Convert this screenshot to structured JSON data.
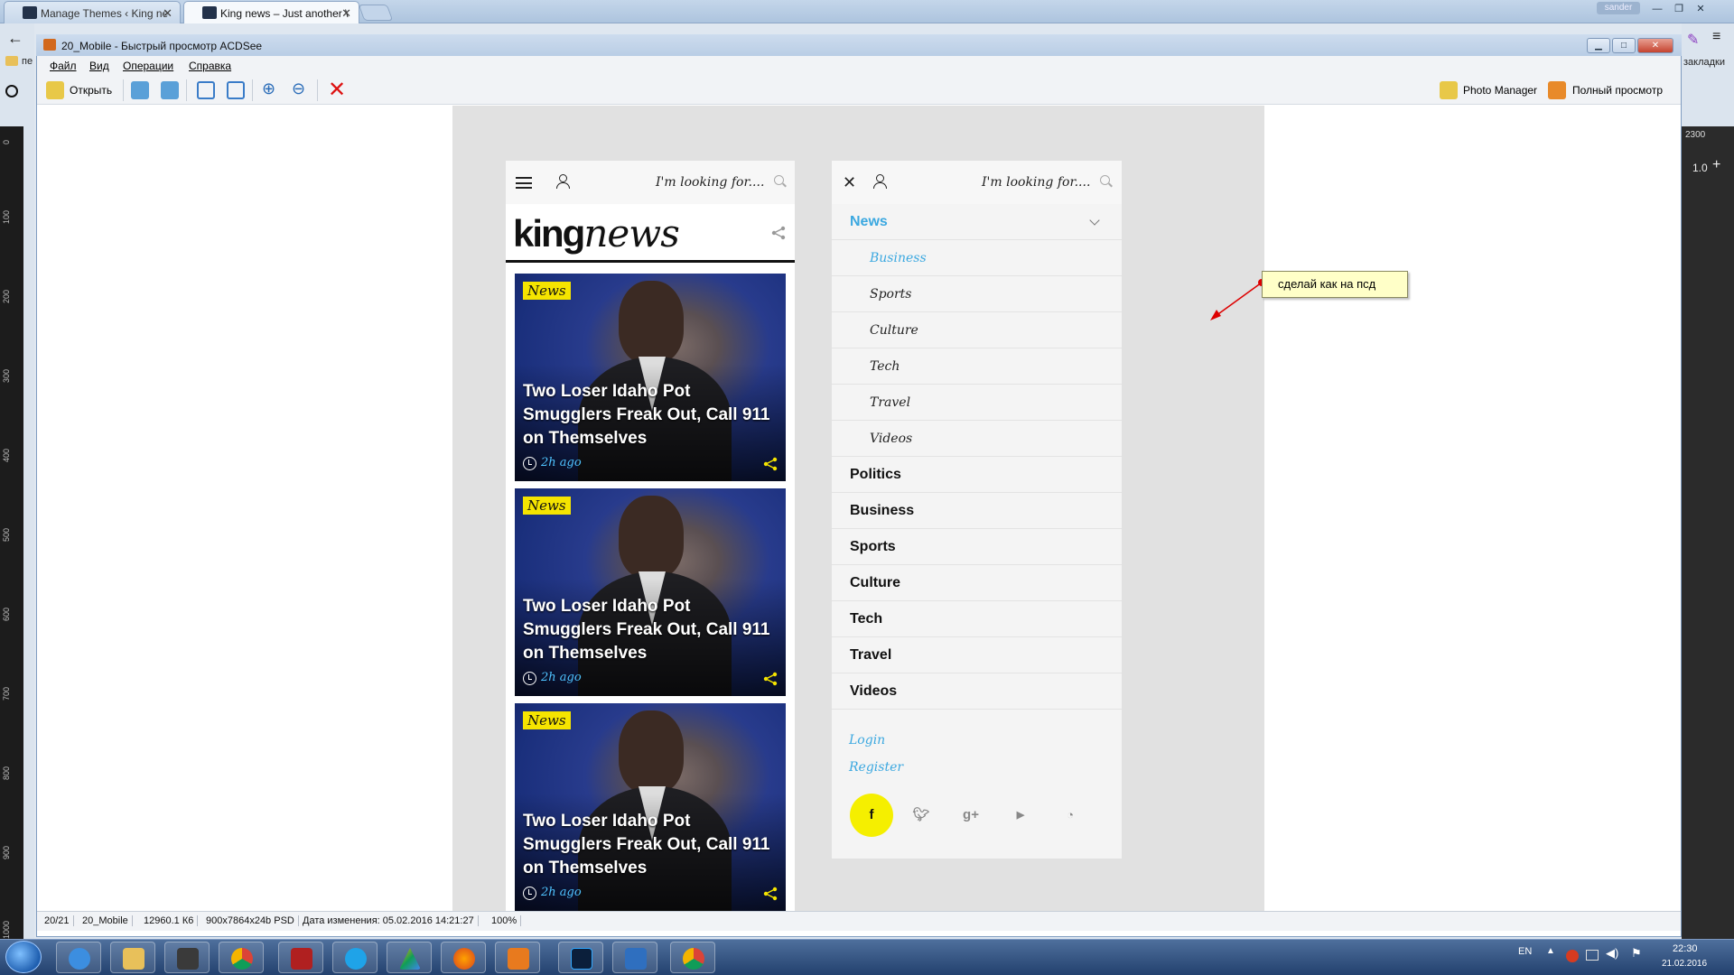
{
  "browser": {
    "tabs": [
      {
        "title": "Manage Themes ‹ King ne"
      },
      {
        "title": "King news – Just another \\"
      }
    ],
    "user": "sander",
    "bookmarks_label": "закладки",
    "folder_label": "пе"
  },
  "right_panel": {
    "ruler_value": "2300",
    "zoom_value": "1.0"
  },
  "ruler_marks": [
    "0",
    "100",
    "200",
    "300",
    "400",
    "500",
    "600",
    "700",
    "800",
    "900",
    "1000"
  ],
  "acdsee": {
    "title": "20_Mobile - Быстрый просмотр ACDSee",
    "menu": [
      "Файл",
      "Вид",
      "Операции",
      "Справка"
    ],
    "toolbar": {
      "open_label": "Открыть",
      "photo_manager_label": "Photo Manager",
      "full_view_label": "Полный просмотр"
    },
    "status": [
      "20/21",
      "20_Mobile",
      "12960.1 К6",
      "900x7864x24b PSD",
      "Дата изменения: 05.02.2016 14:21:27",
      "100%"
    ]
  },
  "mockup": {
    "search_placeholder": "I'm looking for....",
    "logo_bold": "king",
    "logo_italic": "news",
    "cards": [
      {
        "badge": "News",
        "title": "Two Loser Idaho Pot Smugglers Freak Out, Call 911 on Themselves",
        "time": "2h ago"
      },
      {
        "badge": "News",
        "title": "Two Loser Idaho Pot Smugglers Freak Out, Call 911 on Themselves",
        "time": "2h ago"
      },
      {
        "badge": "News",
        "title": "Two Loser Idaho Pot Smugglers Freak Out, Call 911 on Themselves",
        "time": "2h ago"
      }
    ],
    "menu": {
      "active": "News",
      "subitems": [
        "Business",
        "Sports",
        "Culture",
        "Tech",
        "Travel",
        "Videos"
      ],
      "items": [
        "Politics",
        "Business",
        "Sports",
        "Culture",
        "Tech",
        "Travel",
        "Videos"
      ],
      "login": "Login",
      "register": "Register",
      "social": [
        "f",
        "t",
        "g+",
        "yt",
        "rss"
      ]
    },
    "accent_color": "#3ba8e0",
    "badge_color": "#f5e400"
  },
  "annotation": {
    "text": "сделай как на псд"
  },
  "taskbar": {
    "lang": "EN",
    "time": "22:30",
    "date": "21.02.2016"
  }
}
